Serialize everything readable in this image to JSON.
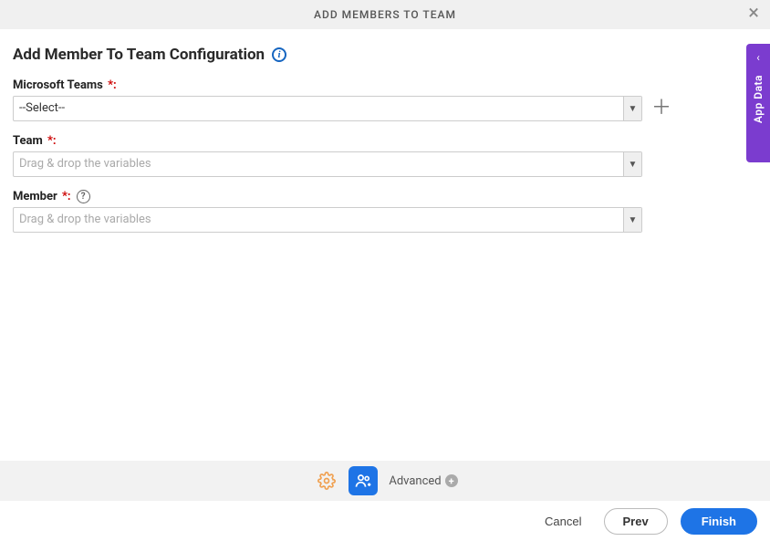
{
  "header": {
    "title": "ADD MEMBERS TO TEAM"
  },
  "page": {
    "title": "Add Member To Team Configuration"
  },
  "fields": {
    "msTeams": {
      "label": "Microsoft Teams",
      "value": "--Select--"
    },
    "team": {
      "label": "Team",
      "placeholder": "Drag & drop the variables"
    },
    "member": {
      "label": "Member",
      "placeholder": "Drag & drop the variables"
    }
  },
  "midBar": {
    "advancedLabel": "Advanced"
  },
  "sideTab": {
    "label": "App Data"
  },
  "footer": {
    "cancel": "Cancel",
    "prev": "Prev",
    "finish": "Finish"
  }
}
